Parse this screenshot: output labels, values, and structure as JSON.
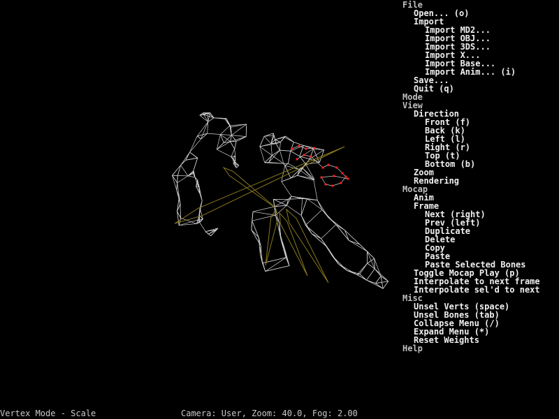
{
  "colors": {
    "menu_top": "#bebebe",
    "menu_sub": "#f0f0f0",
    "mesh": "#d2d2d2",
    "bones": "#8a7a1e",
    "selected_verts": "#ff2020",
    "status_text": "#c8c8c8"
  },
  "menu": [
    {
      "label": "File",
      "level": 0
    },
    {
      "label": "Open... (o)",
      "level": 1
    },
    {
      "label": "Import",
      "level": 1
    },
    {
      "label": "Import MD2...",
      "level": 2
    },
    {
      "label": "Import OBJ...",
      "level": 2
    },
    {
      "label": "Import 3DS...",
      "level": 2
    },
    {
      "label": "Import X...",
      "level": 2
    },
    {
      "label": "Import Base...",
      "level": 2
    },
    {
      "label": "Import Anim... (i)",
      "level": 2
    },
    {
      "label": "Save...",
      "level": 1
    },
    {
      "label": "Quit (q)",
      "level": 1
    },
    {
      "label": "Mode",
      "level": 0
    },
    {
      "label": "View",
      "level": 0
    },
    {
      "label": "Direction",
      "level": 1
    },
    {
      "label": "Front (f)",
      "level": 2
    },
    {
      "label": "Back (k)",
      "level": 2
    },
    {
      "label": "Left (l)",
      "level": 2
    },
    {
      "label": "Right (r)",
      "level": 2
    },
    {
      "label": "Top (t)",
      "level": 2
    },
    {
      "label": "Bottom (b)",
      "level": 2
    },
    {
      "label": "Zoom",
      "level": 1
    },
    {
      "label": "Rendering",
      "level": 1
    },
    {
      "label": "Mocap",
      "level": 0
    },
    {
      "label": "Anim",
      "level": 1
    },
    {
      "label": "Frame",
      "level": 1
    },
    {
      "label": "Next (right)",
      "level": 2
    },
    {
      "label": "Prev (left)",
      "level": 2
    },
    {
      "label": "Duplicate",
      "level": 2
    },
    {
      "label": "Delete",
      "level": 2
    },
    {
      "label": "Copy",
      "level": 2
    },
    {
      "label": "Paste",
      "level": 2
    },
    {
      "label": "Paste Selected Bones",
      "level": 2
    },
    {
      "label": "Toggle Mocap Play (p)",
      "level": 1
    },
    {
      "label": "Interpolate to next frame",
      "level": 1
    },
    {
      "label": "Interpolate sel'd to next",
      "level": 1
    },
    {
      "label": "Misc",
      "level": 0
    },
    {
      "label": "Unsel Verts (space)",
      "level": 1
    },
    {
      "label": "Unsel Bones (tab)",
      "level": 1
    },
    {
      "label": "Collapse Menu (/)",
      "level": 1
    },
    {
      "label": "Expand Menu (*)",
      "level": 1
    },
    {
      "label": "Reset Weights",
      "level": 1
    },
    {
      "label": "Help",
      "level": 0
    }
  ],
  "status": {
    "mode": "Vertex Mode - Scale",
    "camera": "Camera: User, Zoom: 40.0, Fog: 2.00"
  }
}
